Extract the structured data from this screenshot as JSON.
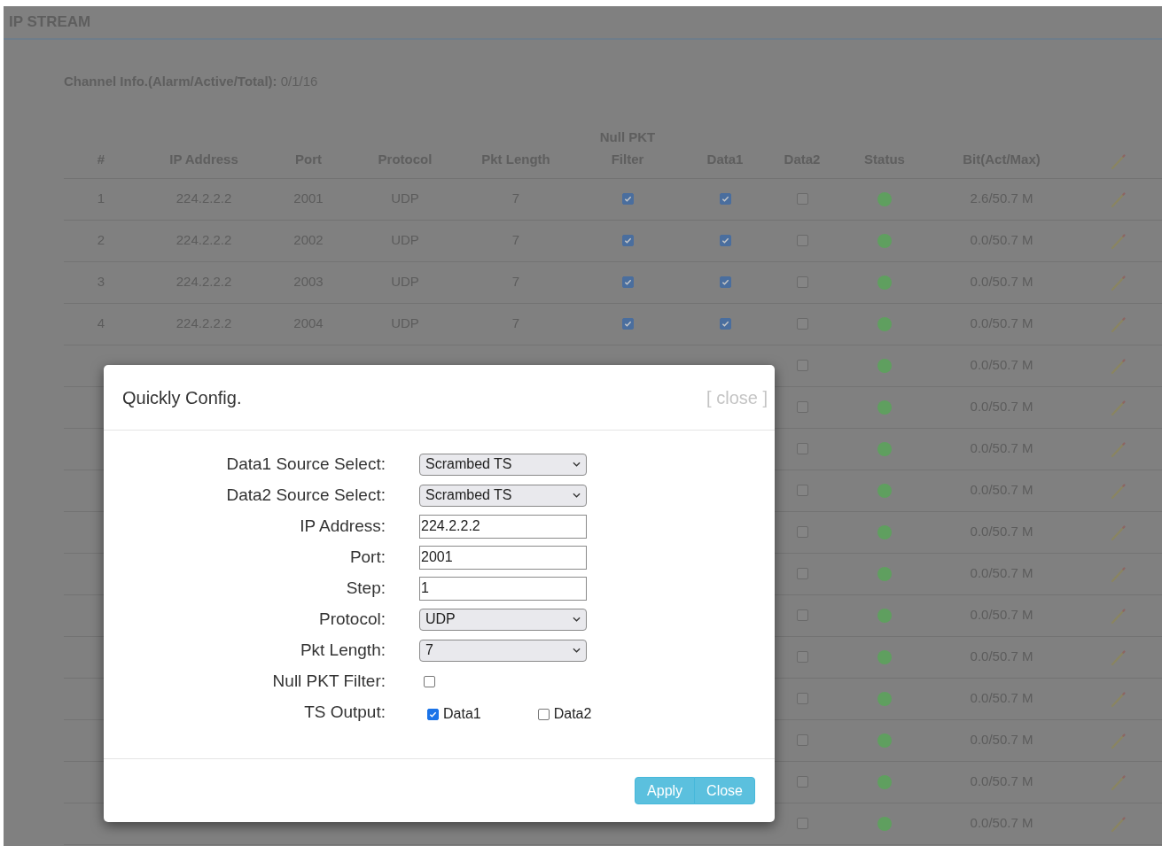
{
  "page": {
    "title": "IP STREAM",
    "channel_info_label": "Channel Info.(Alarm/Active/Total):",
    "channel_info_value": "0/1/16"
  },
  "table": {
    "columns": [
      "#",
      "IP Address",
      "Port",
      "Protocol",
      "Pkt Length",
      "Null PKT Filter",
      "Data1",
      "Data2",
      "Status",
      "Bit(Act/Max)"
    ],
    "rows": [
      {
        "num": "1",
        "ip": "224.2.2.2",
        "port": "2001",
        "protocol": "UDP",
        "pkt_length": "7",
        "null_filter": true,
        "data1": true,
        "data2": false,
        "color": "#5f9f5f",
        "bit": "2.6/50.7 M"
      },
      {
        "num": "2",
        "ip": "224.2.2.2",
        "port": "2002",
        "protocol": "UDP",
        "pkt_length": "7",
        "null_filter": true,
        "data1": true,
        "data2": false,
        "color": "#5f9f5f",
        "bit": "0.0/50.7 M"
      },
      {
        "num": "3",
        "ip": "224.2.2.2",
        "port": "2003",
        "protocol": "UDP",
        "pkt_length": "7",
        "null_filter": true,
        "data1": true,
        "data2": false,
        "color": "#5f9f5f",
        "bit": "0.0/50.7 M"
      },
      {
        "num": "4",
        "ip": "224.2.2.2",
        "port": "2004",
        "protocol": "UDP",
        "pkt_length": "7",
        "null_filter": true,
        "data1": true,
        "data2": false,
        "color": "#5f9f5f",
        "bit": "0.0/50.7 M"
      },
      {
        "data2": false,
        "color": "#5f9f5f",
        "bit": "0.0/50.7 M"
      },
      {
        "data2": false,
        "color": "#5f9f5f",
        "bit": "0.0/50.7 M"
      },
      {
        "data2": false,
        "color": "#5f9f5f",
        "bit": "0.0/50.7 M"
      },
      {
        "data2": false,
        "color": "#5f9f5f",
        "bit": "0.0/50.7 M"
      },
      {
        "data2": false,
        "color": "#5f9f5f",
        "bit": "0.0/50.7 M"
      },
      {
        "data2": false,
        "color": "#5f9f5f",
        "bit": "0.0/50.7 M"
      },
      {
        "data2": false,
        "color": "#5f9f5f",
        "bit": "0.0/50.7 M"
      },
      {
        "data2": false,
        "color": "#5f9f5f",
        "bit": "0.0/50.7 M"
      },
      {
        "data2": false,
        "color": "#5f9f5f",
        "bit": "0.0/50.7 M"
      },
      {
        "data2": false,
        "color": "#5f9f5f",
        "bit": "0.0/50.7 M"
      },
      {
        "data2": false,
        "color": "#5f9f5f",
        "bit": "0.0/50.7 M"
      },
      {
        "data2": false,
        "color": "#5f9f5f",
        "bit": "0.0/50.7 M"
      }
    ]
  },
  "dialog": {
    "title": "Quickly Config.",
    "close_link": "[ close ]",
    "fields": [
      {
        "kind": "select",
        "label": "Data1 Source Select:",
        "value": "Scrambed TS"
      },
      {
        "kind": "select",
        "label": "Data2 Source Select:",
        "value": "Scrambed TS"
      },
      {
        "kind": "text",
        "label": "IP Address:",
        "value": "224.2.2.2"
      },
      {
        "kind": "text",
        "label": "Port:",
        "value": "2001"
      },
      {
        "kind": "text",
        "label": "Step:",
        "value": "1"
      },
      {
        "kind": "select",
        "label": "Protocol:",
        "value": "UDP"
      },
      {
        "kind": "select",
        "label": "Pkt Length:",
        "value": "7"
      },
      {
        "kind": "checkbox",
        "label": "Null PKT Filter:",
        "checked": false
      },
      {
        "kind": "checks",
        "label": "TS Output:",
        "options": [
          {
            "label": "Data1",
            "checked": true
          },
          {
            "label": "Data2",
            "checked": false
          }
        ]
      }
    ],
    "buttons": [
      "Apply",
      "Close"
    ]
  }
}
